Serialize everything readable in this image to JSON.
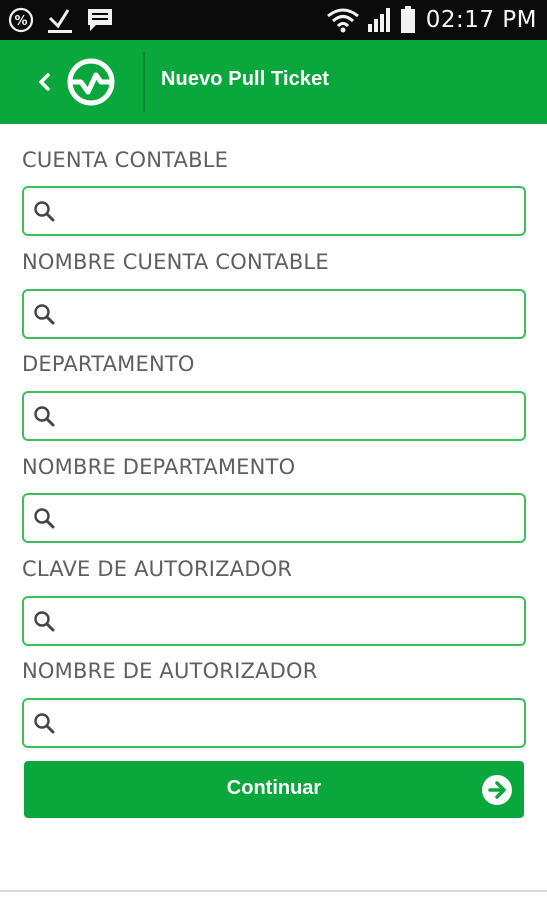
{
  "status_bar": {
    "time": "02:17 PM",
    "left_icons": [
      "percent-icon",
      "download-check-icon",
      "message-icon"
    ],
    "right_icons": [
      "wifi-icon",
      "signal-icon",
      "battery-icon"
    ]
  },
  "app_bar": {
    "title": "Nuevo Pull Ticket",
    "back_icon": "chevron-left-icon",
    "logo_icon": "brand-logo-icon"
  },
  "form": {
    "fields": [
      {
        "label": "CUENTA CONTABLE",
        "value": "",
        "placeholder": "",
        "icon": "search-icon"
      },
      {
        "label": "NOMBRE CUENTA CONTABLE",
        "value": "",
        "placeholder": "",
        "icon": "search-icon"
      },
      {
        "label": "DEPARTAMENTO",
        "value": "",
        "placeholder": "",
        "icon": "search-icon"
      },
      {
        "label": "NOMBRE DEPARTAMENTO",
        "value": "",
        "placeholder": "",
        "icon": "search-icon"
      },
      {
        "label": "CLAVE DE AUTORIZADOR",
        "value": "",
        "placeholder": "",
        "icon": "search-icon"
      },
      {
        "label": "NOMBRE DE AUTORIZADOR",
        "value": "",
        "placeholder": "",
        "icon": "search-icon"
      }
    ],
    "continue_label": "Continuar",
    "continue_icon": "arrow-right-icon"
  },
  "colors": {
    "brand_green": "#0aa83c",
    "field_border": "#3cbf5b",
    "label_gray": "#5f5f5f"
  }
}
